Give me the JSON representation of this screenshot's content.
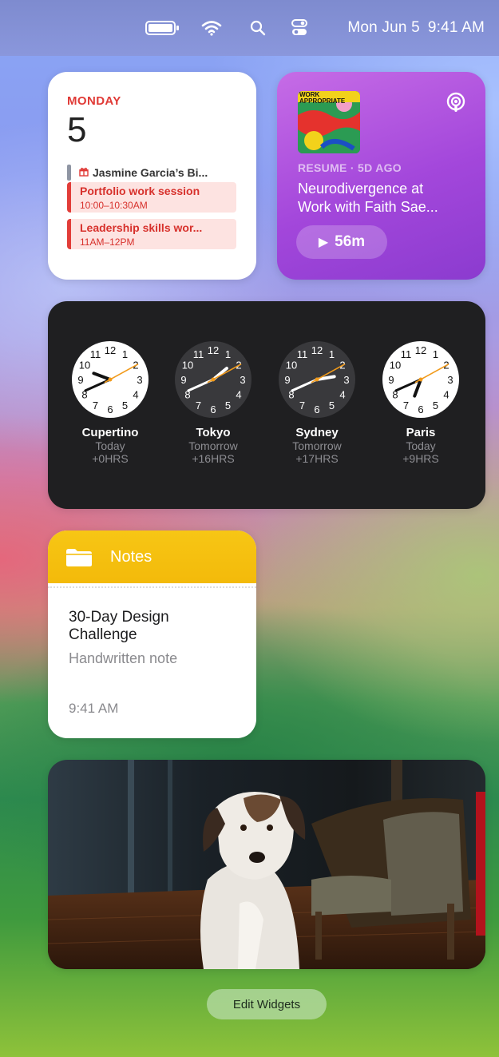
{
  "menubar": {
    "date": "Mon Jun 5",
    "time": "9:41 AM",
    "icons": [
      "battery-icon",
      "wifi-icon",
      "search-icon",
      "control-center-icon"
    ]
  },
  "calendar_widget": {
    "weekday": "MONDAY",
    "day_number": "5",
    "birthday": "Jasmine Garcia’s Bi...",
    "events": [
      {
        "title": "Portfolio work session",
        "time": "10:00–10:30AM"
      },
      {
        "title": "Leadership skills wor...",
        "time": "11AM–12PM"
      }
    ],
    "accent_color": "#e03a36"
  },
  "podcast_widget": {
    "artwork_text": "WORK APPROPRIATE",
    "status": "RESUME · 5D AGO",
    "title_line1": "Neurodivergence at",
    "title_line2": "Work with Faith Sae...",
    "duration": "56m",
    "play_glyph": "▶"
  },
  "world_clock_widget": {
    "clocks": [
      {
        "city": "Cupertino",
        "day": "Today",
        "offset": "+0HRS",
        "face": "light",
        "hour": 9,
        "minute": 41
      },
      {
        "city": "Tokyo",
        "day": "Tomorrow",
        "offset": "+16HRS",
        "face": "dark",
        "hour": 1,
        "minute": 41
      },
      {
        "city": "Sydney",
        "day": "Tomorrow",
        "offset": "+17HRS",
        "face": "dark",
        "hour": 2,
        "minute": 41
      },
      {
        "city": "Paris",
        "day": "Today",
        "offset": "+9HRS",
        "face": "light",
        "hour": 6,
        "minute": 41
      }
    ]
  },
  "notes_widget": {
    "app_name": "Notes",
    "note_title_line1": "30-Day Design",
    "note_title_line2": "Challenge",
    "note_subtitle": "Handwritten note",
    "note_time": "9:41 AM"
  },
  "photo_widget": {
    "subject": "dog-in-room-photo"
  },
  "edit_widgets_label": "Edit Widgets"
}
